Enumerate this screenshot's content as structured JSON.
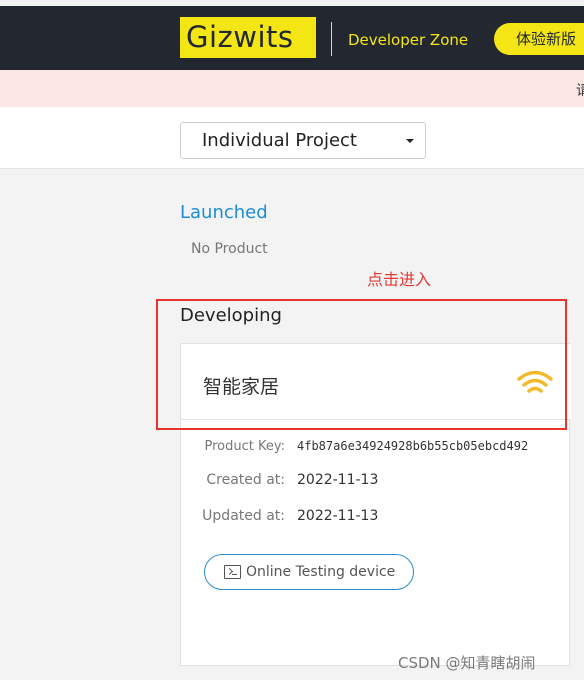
{
  "header": {
    "logo_text": "Gizwits",
    "zone_label": "Developer Zone",
    "try_new_button": "体验新版",
    "brand_color": "#f4e615",
    "bar_color": "#23272f"
  },
  "notice": {
    "text": "请"
  },
  "project_selector": {
    "selected": "Individual Project"
  },
  "sections": {
    "launched_title": "Launched",
    "launched_empty": "No Product",
    "developing_title": "Developing"
  },
  "annotation": {
    "text": "点击进入",
    "color": "#e53935"
  },
  "product_card": {
    "title": "智能家居",
    "icon": "wifi-icon",
    "product_key_label": "Product Key:",
    "product_key_value": "4fb87a6e34924928b6b55cb05ebcd492",
    "created_label": "Created at:",
    "created_value": "2022-11-13",
    "updated_label": "Updated at:",
    "updated_value": "2022-11-13",
    "online_button": "Online Testing device"
  },
  "watermark": "CSDN @知青瞎胡闹"
}
